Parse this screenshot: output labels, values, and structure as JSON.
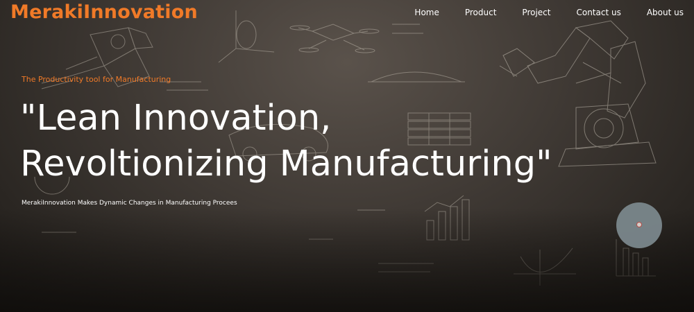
{
  "header": {
    "logo": "MerakiInnovation",
    "nav": [
      "Home",
      "Product",
      "Project",
      "Contact us",
      "About us"
    ]
  },
  "hero": {
    "tagline": "The Productivity tool for Manufacturing",
    "headline_line1": "\"Lean Innovation,",
    "headline_line2": "Revoltionizing Manufacturing\"",
    "subtext": "MerakiInnovation Makes Dynamic Changes in Manufacturing Procees"
  },
  "colors": {
    "accent": "#f07a28",
    "text": "#ffffff",
    "floating_button": "#7d8a8f"
  },
  "icons": {
    "floating_button": "circle-dot-icon"
  }
}
